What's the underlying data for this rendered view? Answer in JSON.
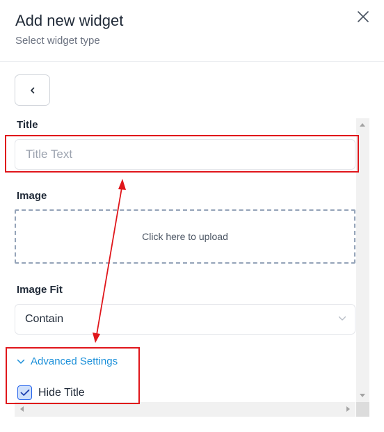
{
  "modal": {
    "title": "Add new widget",
    "subtitle": "Select widget type"
  },
  "form": {
    "title_label": "Title",
    "title_placeholder": "Title Text",
    "title_value": "",
    "image_label": "Image",
    "upload_text": "Click here to upload",
    "image_fit_label": "Image Fit",
    "image_fit_value": "Contain",
    "advanced_settings_label": "Advanced Settings",
    "hide_title_label": "Hide Title",
    "hide_title_checked": true
  },
  "colors": {
    "accent": "#1a8fd9",
    "checkbox_border": "#2563eb",
    "checkbox_fill": "#cfe0fb",
    "annotation": "#e0161b",
    "text_primary": "#1f2937",
    "text_secondary": "#6b7280"
  },
  "icons": {
    "close": "close-icon",
    "back": "chevron-left-icon",
    "select": "chevron-down-icon",
    "advanced": "chevron-down-icon",
    "checkbox": "check-icon"
  }
}
